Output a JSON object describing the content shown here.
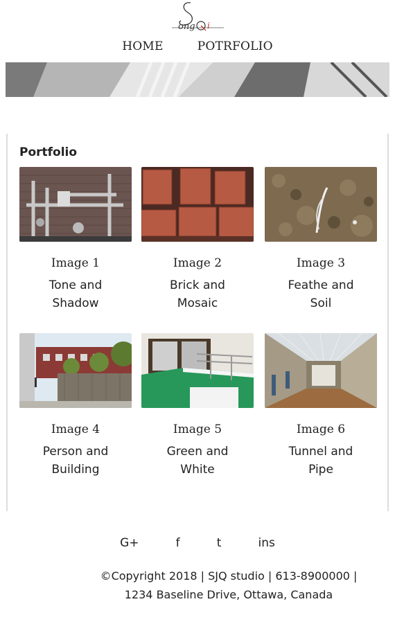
{
  "brand": {
    "logo_text": "SongQi"
  },
  "nav": [
    {
      "label": "HOME"
    },
    {
      "label": "POTRFOLIO"
    }
  ],
  "portfolio": {
    "title": "Portfolio",
    "items": [
      {
        "caption": "Image 1",
        "description": "Tone and Shadow"
      },
      {
        "caption": "Image 2",
        "description": "Brick and Mosaic"
      },
      {
        "caption": "Image 3",
        "description": "Feathe and Soil"
      },
      {
        "caption": "Image 4",
        "description": "Person and Building"
      },
      {
        "caption": "Image 5",
        "description": "Green and White"
      },
      {
        "caption": "Image 6",
        "description": "Tunnel and Pipe"
      }
    ]
  },
  "social": [
    {
      "label": "G+"
    },
    {
      "label": "f"
    },
    {
      "label": "t"
    },
    {
      "label": "ins"
    }
  ],
  "footer": {
    "line1": "©Copyright 2018 | SJQ studio | 613-8900000 |",
    "line2": "1234 Baseline Drive, Ottawa, Canada"
  }
}
